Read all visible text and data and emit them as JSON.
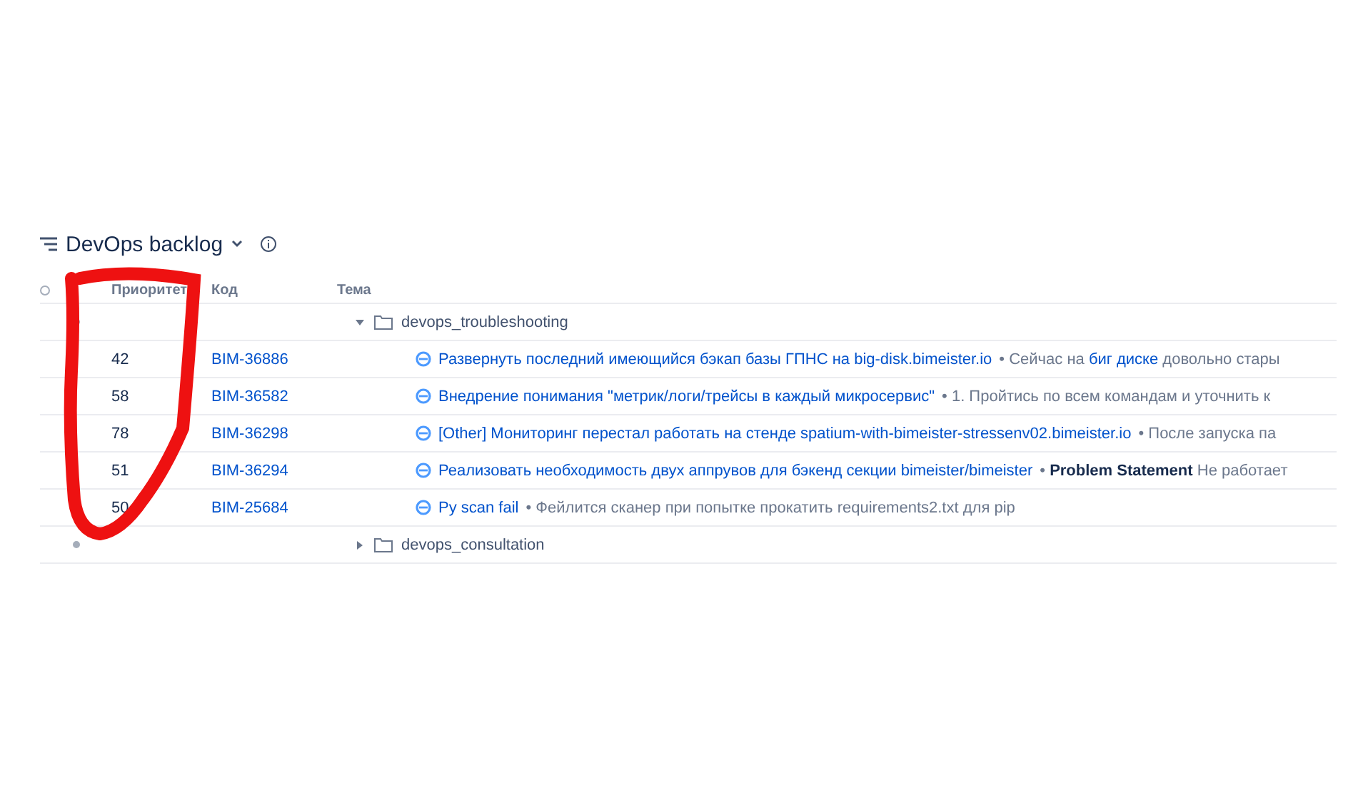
{
  "board": {
    "title": "DevOps backlog"
  },
  "columns": [
    "Приоритет",
    "Код",
    "Тема"
  ],
  "separator": "•",
  "groups": [
    {
      "name": "devops_troubleshooting",
      "expanded": true,
      "issues": [
        {
          "priority": "42",
          "key": "BIM-36886",
          "summary": "Развернуть последний имеющийся бэкап базы ГПНС на big-disk.bimeister.io",
          "description": [
            {
              "kind": "plain",
              "text": "Сейчас на"
            },
            {
              "kind": "link",
              "text": "биг диске"
            },
            {
              "kind": "plain",
              "text": "довольно стары"
            }
          ]
        },
        {
          "priority": "58",
          "key": "BIM-36582",
          "summary": "Внедрение понимания \"метрик/логи/трейсы в каждый микросервис\"",
          "description": [
            {
              "kind": "plain",
              "text": "1. Пройтись по всем командам и уточнить к"
            }
          ]
        },
        {
          "priority": "78",
          "key": "BIM-36298",
          "summary": "[Other] Мониторинг перестал работать на стенде spatium-with-bimeister-stressenv02.bimeister.io",
          "description": [
            {
              "kind": "plain",
              "text": "После запуска па"
            }
          ]
        },
        {
          "priority": "51",
          "key": "BIM-36294",
          "summary": "Реализовать необходимость двух аппрувов для бэкенд секции bimeister/bimeister",
          "description": [
            {
              "kind": "bold",
              "text": "Problem Statement"
            },
            {
              "kind": "plain",
              "text": "Не работает"
            }
          ]
        },
        {
          "priority": "50",
          "key": "BIM-25684",
          "summary": "Py scan fail",
          "description": [
            {
              "kind": "plain",
              "text": "Фейлится сканер при попытке прокатить requirements2.txt для pip"
            }
          ]
        }
      ]
    },
    {
      "name": "devops_consultation",
      "expanded": false
    }
  ]
}
